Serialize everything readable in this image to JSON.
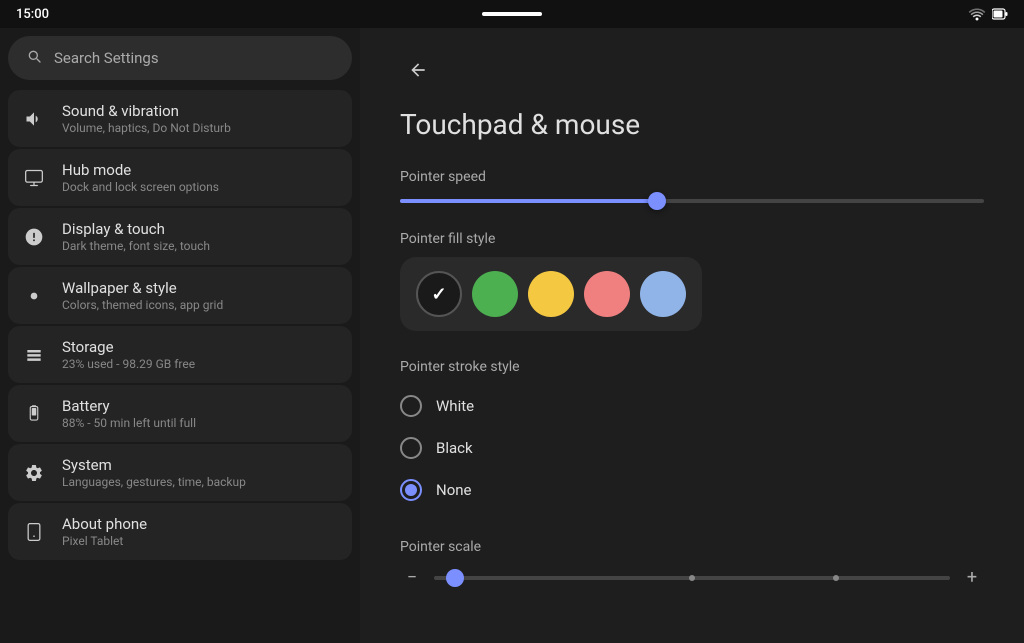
{
  "statusBar": {
    "time": "15:00"
  },
  "sidebar": {
    "searchPlaceholder": "Search Settings",
    "items": [
      {
        "id": "sound",
        "title": "Sound & vibration",
        "subtitle": "Volume, haptics, Do Not Disturb",
        "icon": "🔊"
      },
      {
        "id": "hub",
        "title": "Hub mode",
        "subtitle": "Dock and lock screen options",
        "icon": "🖥"
      },
      {
        "id": "display",
        "title": "Display & touch",
        "subtitle": "Dark theme, font size, touch",
        "icon": "⚙"
      },
      {
        "id": "wallpaper",
        "title": "Wallpaper & style",
        "subtitle": "Colors, themed icons, app grid",
        "icon": "🎨"
      },
      {
        "id": "storage",
        "title": "Storage",
        "subtitle": "23% used - 98.29 GB free",
        "icon": "☰"
      },
      {
        "id": "battery",
        "title": "Battery",
        "subtitle": "88% - 50 min left until full",
        "icon": "🔋"
      },
      {
        "id": "system",
        "title": "System",
        "subtitle": "Languages, gestures, time, backup",
        "icon": "⚙"
      },
      {
        "id": "about",
        "title": "About phone",
        "subtitle": "Pixel Tablet",
        "icon": "📱"
      }
    ]
  },
  "content": {
    "backLabel": "←",
    "title": "Touchpad & mouse",
    "pointerSpeed": {
      "label": "Pointer speed",
      "value": 44
    },
    "pointerFillStyle": {
      "label": "Pointer fill style",
      "colors": [
        {
          "id": "black",
          "hex": "#1a1a1a",
          "selected": true
        },
        {
          "id": "green",
          "hex": "#4caf50",
          "selected": false
        },
        {
          "id": "yellow",
          "hex": "#f5c842",
          "selected": false
        },
        {
          "id": "pink",
          "hex": "#f08080",
          "selected": false
        },
        {
          "id": "blue",
          "hex": "#90b4e8",
          "selected": false
        }
      ]
    },
    "pointerStrokeStyle": {
      "label": "Pointer stroke style",
      "options": [
        {
          "id": "white",
          "label": "White",
          "selected": false
        },
        {
          "id": "black",
          "label": "Black",
          "selected": false
        },
        {
          "id": "none",
          "label": "None",
          "selected": true
        }
      ]
    },
    "pointerScale": {
      "label": "Pointer scale",
      "minusIcon": "−",
      "plusIcon": "+",
      "value": 4,
      "ticks": [
        50,
        78
      ]
    }
  }
}
